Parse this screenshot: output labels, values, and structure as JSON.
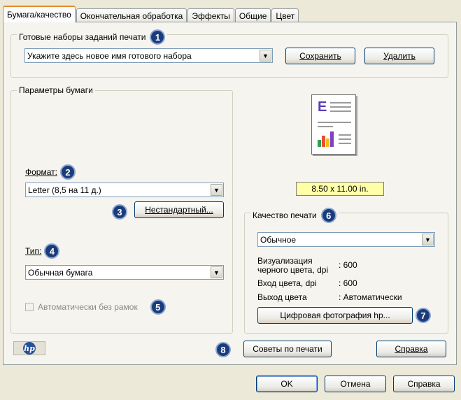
{
  "tabs": [
    "Бумага/качество",
    "Окончательная обработка",
    "Эффекты",
    "Общие",
    "Цвет"
  ],
  "presets": {
    "legend": "Готовые наборы заданий печати",
    "badge": "1",
    "combo_value": "Укажите здесь новое имя готового набора",
    "save_label": "Сохранить",
    "delete_label": "Удалить"
  },
  "paper": {
    "legend": "Параметры бумаги",
    "format_label": "Формат:",
    "format_badge": "2",
    "format_value": "Letter (8,5 на 11 д.)",
    "custom_badge": "3",
    "custom_label": "Нестандартный...",
    "type_label": "Тип:",
    "type_badge": "4",
    "type_value": "Обычная бумага",
    "borderless_label": "Автоматически без рамок",
    "borderless_badge": "5",
    "borderless_checked": false
  },
  "preview": {
    "size_label": "8.50 x 11.00 in.",
    "page_letter": "E"
  },
  "quality": {
    "legend": "Качество печати",
    "badge": "6",
    "value": "Обычное",
    "info": [
      {
        "key": "Визуализация черного цвета, dpi",
        "value": ": 600"
      },
      {
        "key": "Вход цвета, dpi",
        "value": ": 600"
      },
      {
        "key": "Выход цвета",
        "value": ": Автоматически"
      }
    ],
    "photo_button": "Цифровая фотография hp...",
    "photo_badge": "7"
  },
  "bottom": {
    "logo": "hp",
    "tips_badge": "8",
    "tips_button": "Советы по печати",
    "help_button": "Справка"
  },
  "dialog_buttons": {
    "ok": "OK",
    "cancel": "Отмена",
    "help": "Справка"
  },
  "colors": {
    "badge": "#1b3c7a",
    "size_label_bg": "#ffffa8",
    "hp_logo": "#27509a"
  }
}
